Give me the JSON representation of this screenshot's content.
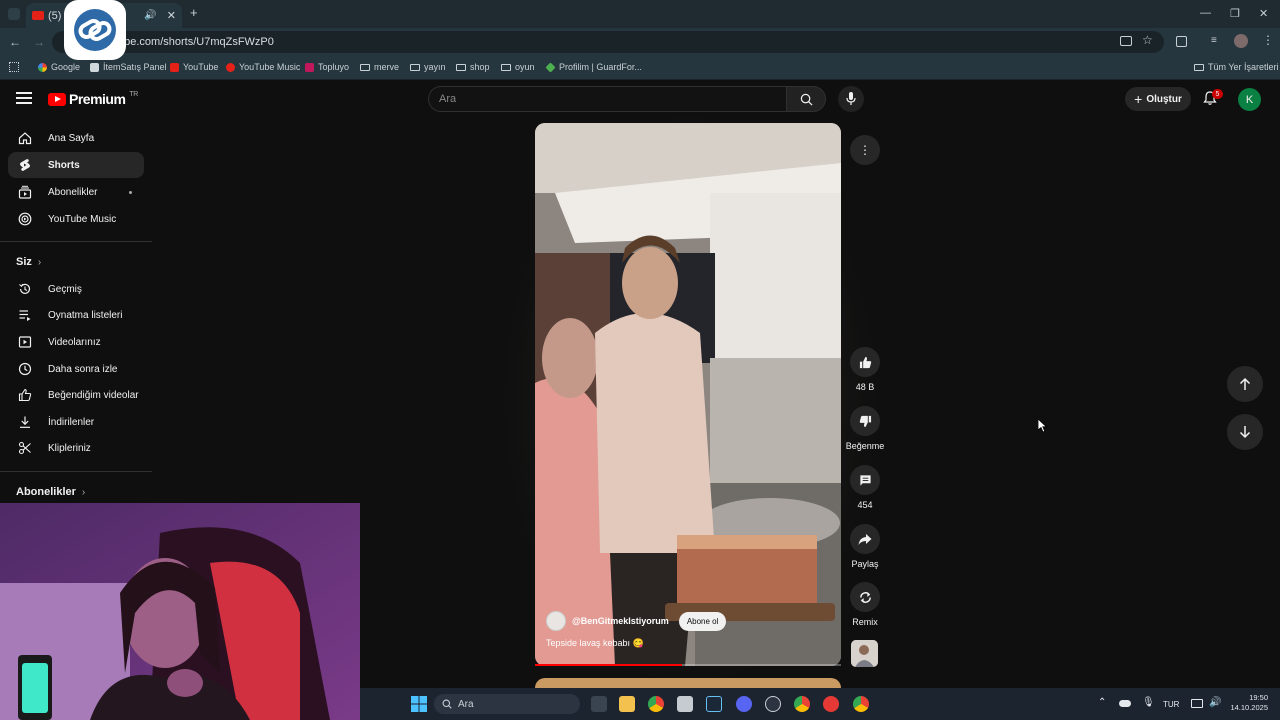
{
  "browser": {
    "tab_title": "(5) T",
    "url": "ube.com/shorts/U7mqZsFWzP0",
    "bookmarks": [
      {
        "label": "Google",
        "icon": "google-icon"
      },
      {
        "label": "İtemSatış Panel",
        "icon": "itemsatis-icon"
      },
      {
        "label": "YouTube",
        "icon": "youtube-icon"
      },
      {
        "label": "YouTube Music",
        "icon": "youtube-music-icon"
      },
      {
        "label": "Topluyo",
        "icon": "topluyo-icon"
      },
      {
        "label": "merve",
        "icon": "folder-icon"
      },
      {
        "label": "yayın",
        "icon": "folder-icon"
      },
      {
        "label": "shop",
        "icon": "folder-icon"
      },
      {
        "label": "oyun",
        "icon": "folder-icon"
      },
      {
        "label": "Profilim | GuardFor...",
        "icon": "guardfor-icon"
      }
    ],
    "all_bookmarks": "Tüm Yer İşaretleri"
  },
  "header": {
    "logo_text": "Premium",
    "region": "TR",
    "search_placeholder": "Ara",
    "create_label": "Oluştur",
    "notification_count": "5",
    "avatar_letter": "K"
  },
  "sidebar": {
    "main": [
      {
        "label": "Ana Sayfa",
        "icon": "home-icon"
      },
      {
        "label": "Shorts",
        "icon": "shorts-icon",
        "active": true
      },
      {
        "label": "Abonelikler",
        "icon": "subscriptions-icon"
      },
      {
        "label": "YouTube Music",
        "icon": "youtube-music-icon"
      }
    ],
    "you_header": "Siz",
    "you": [
      {
        "label": "Geçmiş",
        "icon": "history-icon"
      },
      {
        "label": "Oynatma listeleri",
        "icon": "playlists-icon"
      },
      {
        "label": "Videolarınız",
        "icon": "your-videos-icon"
      },
      {
        "label": "Daha sonra izle",
        "icon": "watch-later-icon"
      },
      {
        "label": "Beğendiğim videolar",
        "icon": "liked-icon"
      },
      {
        "label": "İndirilenler",
        "icon": "downloads-icon"
      },
      {
        "label": "Klipleriniz",
        "icon": "clips-icon"
      }
    ],
    "subs_header": "Abonelikler"
  },
  "short": {
    "channel": "@BenGitmekIstiyorum",
    "subscribe_label": "Abone ol",
    "title": "Tepside lavaş kebabı 😋",
    "progress": 0.48,
    "actions": {
      "likes": "48 B",
      "dislike": "Beğenme",
      "comments": "454",
      "share": "Paylaş",
      "remix": "Remix"
    }
  },
  "taskbar": {
    "search_placeholder": "Ara",
    "lang": "TUR",
    "time": "19:50",
    "date": "14.10.2025"
  }
}
